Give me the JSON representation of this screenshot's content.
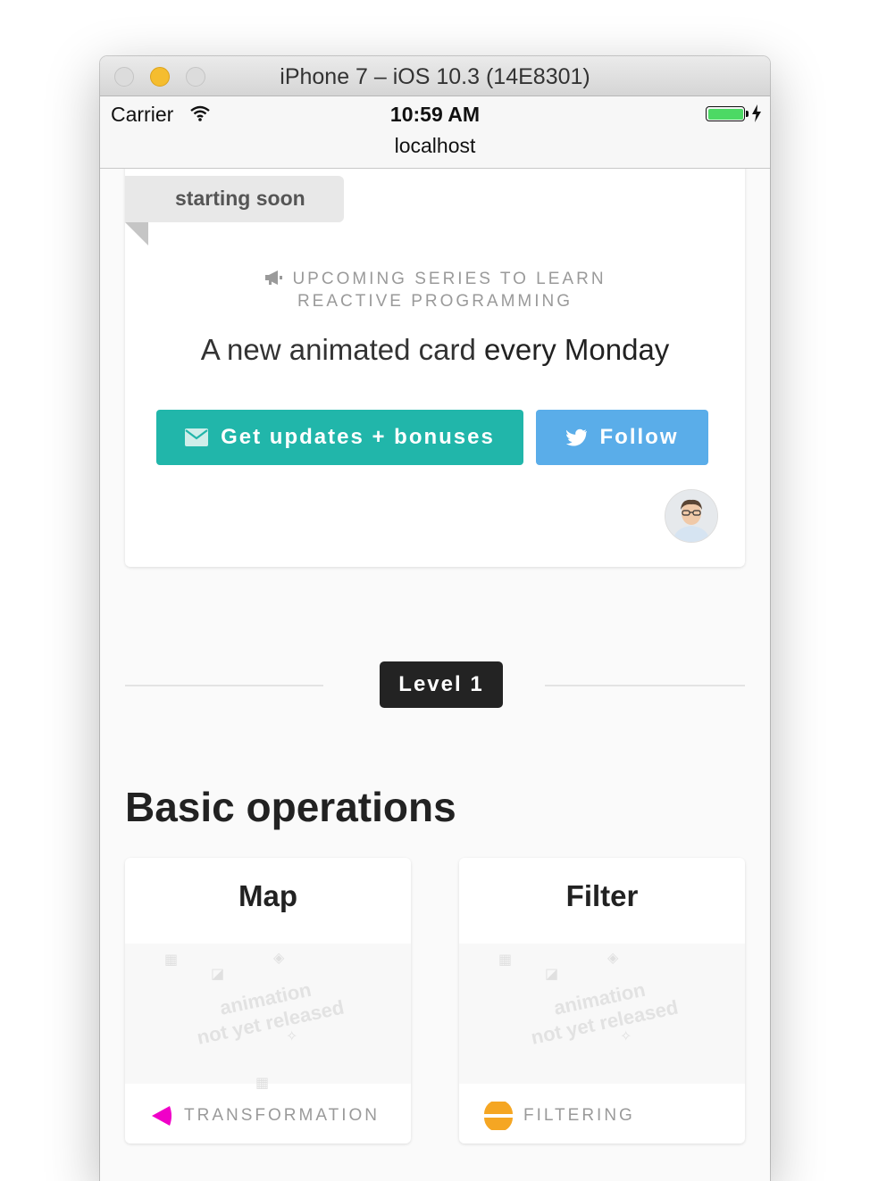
{
  "window": {
    "title": "iPhone 7 – iOS 10.3 (14E8301)"
  },
  "status_bar": {
    "carrier": "Carrier",
    "time": "10:59 AM",
    "url": "localhost",
    "battery_color": "#4cd964"
  },
  "promo_card": {
    "ribbon": "starting soon",
    "announcement": "UPCOMING SERIES TO LEARN REACTIVE PROGRAMMING",
    "headline_light": "A new animated card ",
    "headline_strong": "every Monday",
    "updates_button": "Get updates + bonuses",
    "follow_button": "Follow",
    "updates_color": "#21b6aa",
    "follow_color": "#5aade9"
  },
  "level_badge": "Level 1",
  "section": {
    "title": "Basic operations",
    "cards": [
      {
        "title": "Map",
        "preview_line1": "animation",
        "preview_line2": "not yet released",
        "category": "TRANSFORMATION",
        "category_icon": "transformation-icon",
        "category_color": "#f000c8"
      },
      {
        "title": "Filter",
        "preview_line1": "animation",
        "preview_line2": "not yet released",
        "category": "FILTERING",
        "category_icon": "filtering-icon",
        "category_color": "#f5a623"
      }
    ]
  }
}
